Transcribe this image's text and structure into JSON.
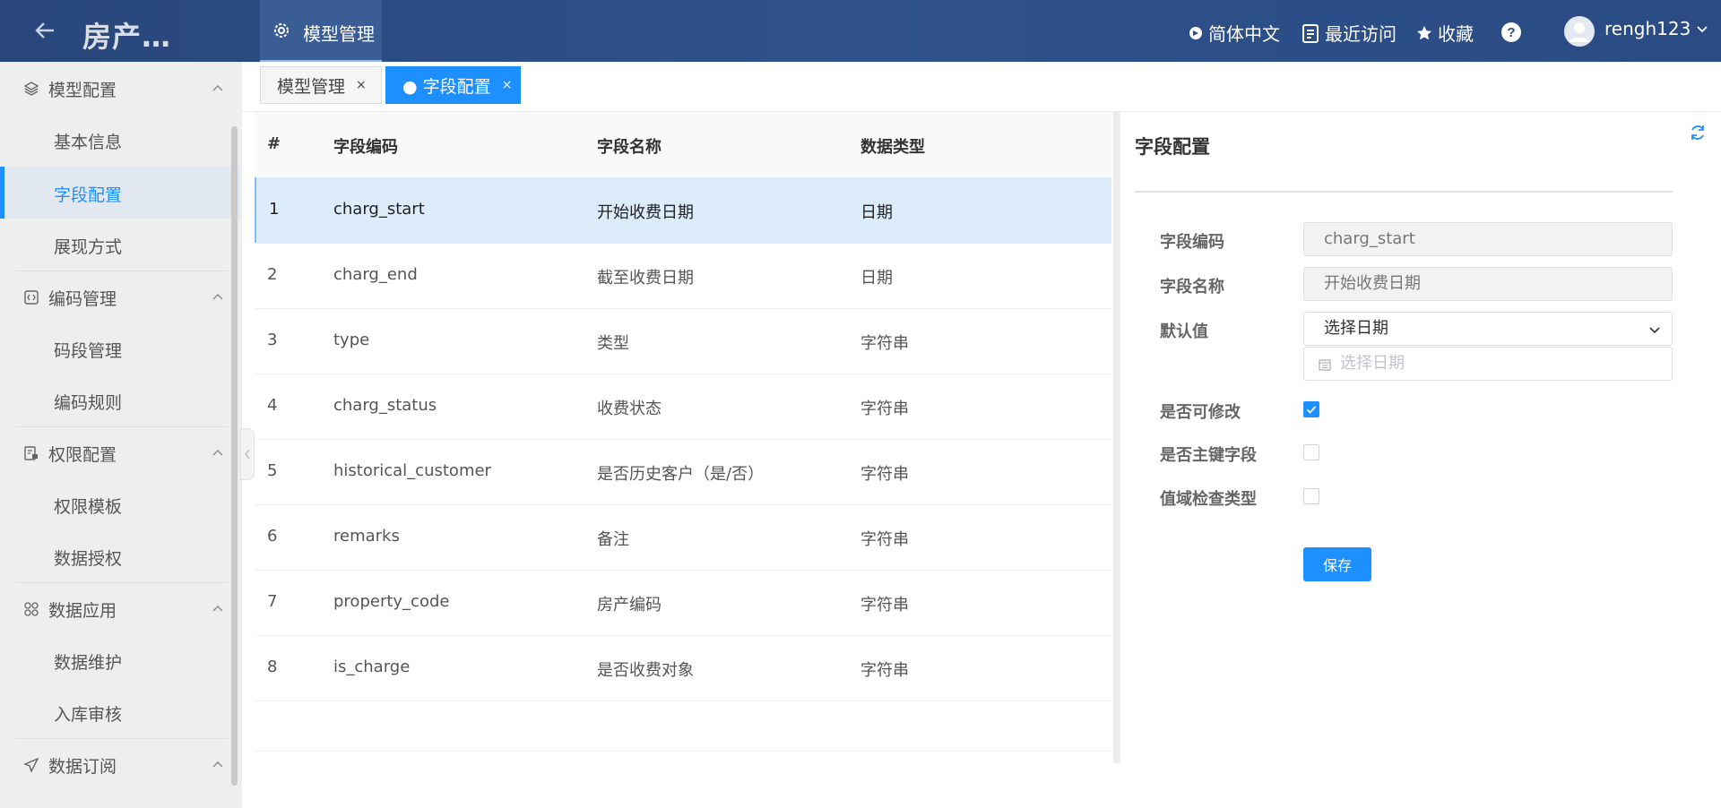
{
  "header": {
    "app_title": "房产…",
    "top_tab_label": "模型管理",
    "language": "简体中文",
    "recent": "最近访问",
    "favorites": "收藏",
    "username": "rengh123"
  },
  "sidebar": {
    "groups": [
      {
        "label": "模型配置",
        "items": [
          "基本信息",
          "字段配置",
          "展现方式"
        ]
      },
      {
        "label": "编码管理",
        "items": [
          "码段管理",
          "编码规则"
        ]
      },
      {
        "label": "权限配置",
        "items": [
          "权限模板",
          "数据授权"
        ]
      },
      {
        "label": "数据应用",
        "items": [
          "数据维护",
          "入库审核"
        ]
      },
      {
        "label": "数据订阅",
        "items": []
      }
    ],
    "active_item": "字段配置"
  },
  "tabs": [
    {
      "label": "模型管理",
      "close": "×"
    },
    {
      "label": "● 字段配置",
      "close": "×"
    }
  ],
  "table": {
    "headers": [
      "#",
      "字段编码",
      "字段名称",
      "数据类型"
    ],
    "rows": [
      [
        "1",
        "charg_start",
        "开始收费日期",
        "日期"
      ],
      [
        "2",
        "charg_end",
        "截至收费日期",
        "日期"
      ],
      [
        "3",
        "type",
        "类型",
        "字符串"
      ],
      [
        "4",
        "charg_status",
        "收费状态",
        "字符串"
      ],
      [
        "5",
        "historical_customer",
        "是否历史客户（是/否）",
        "字符串"
      ],
      [
        "6",
        "remarks",
        "备注",
        "字符串"
      ],
      [
        "7",
        "property_code",
        "房产编码",
        "字符串"
      ],
      [
        "8",
        "is_charge",
        "是否收费对象",
        "字符串"
      ]
    ]
  },
  "panel": {
    "title": "字段配置",
    "code_label": "字段编码",
    "code_value": "charg_start",
    "name_label": "字段名称",
    "name_value": "开始收费日期",
    "default_label": "默认值",
    "default_select": "选择日期",
    "date_placeholder": "选择日期",
    "editable_label": "是否可修改",
    "editable_checked": true,
    "pk_label": "是否主键字段",
    "pk_checked": false,
    "domain_label": "值域检查类型",
    "domain_checked": false,
    "save_label": "保存"
  },
  "colors": {
    "accent": "#1e8fff",
    "header": "#2a4b84",
    "selected_row": "#dcecfb"
  }
}
